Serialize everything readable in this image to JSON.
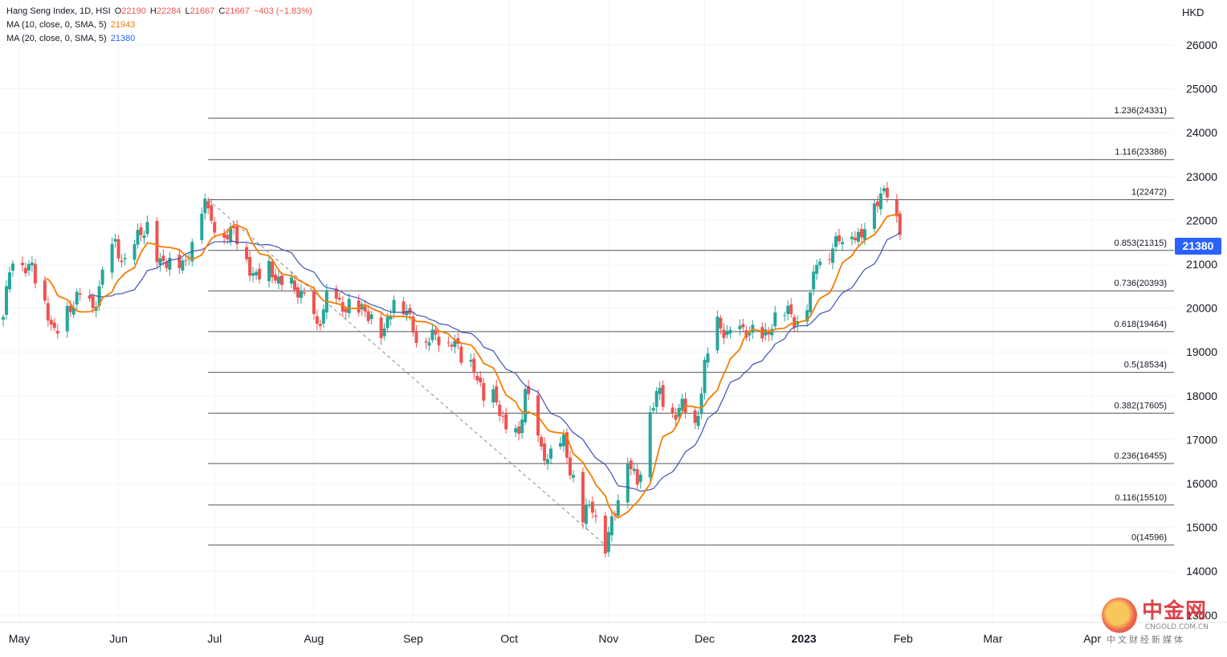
{
  "legend": {
    "symbol": "Hang Seng Index, 1D, HSI",
    "open_label": "O",
    "open": "22190",
    "high_label": "H",
    "high": "22284",
    "low_label": "L",
    "low": "21667",
    "close_label": "C",
    "close": "21667",
    "change": "−403 (−1.83%)",
    "ma10_label": "MA (10, close, 0, SMA, 5)",
    "ma10_value": "21943",
    "ma20_label": "MA (20, close, 0, SMA, 5)",
    "ma20_value": "21380"
  },
  "currency": "HKD",
  "last_price_badge": "21380",
  "watermark": {
    "title": "中金网",
    "url": "CNGOLD.COM.CN",
    "subtitle": "中文财经新媒体"
  },
  "colors": {
    "up": "#26a69a",
    "down": "#ef5350",
    "ma10": "#f57c00",
    "ma20": "#3f51b5",
    "fib_line": "#555555",
    "badge": "#2962ff",
    "legend_red": "#ef5350",
    "legend_orange": "#f57c00",
    "legend_blue": "#2962ff"
  },
  "chart_data": {
    "type": "candlestick",
    "title": "Hang Seng Index, 1D, HSI",
    "ylabel": "HKD",
    "ylim": [
      13000,
      26700
    ],
    "y_ticks": [
      26000,
      25000,
      24000,
      23000,
      22000,
      21000,
      20000,
      19000,
      18000,
      17000,
      16000,
      15000,
      14000,
      13000
    ],
    "x_ticks": [
      {
        "label": "May",
        "date": "2022-05-01"
      },
      {
        "label": "Jun",
        "date": "2022-06-01"
      },
      {
        "label": "Jul",
        "date": "2022-07-01"
      },
      {
        "label": "Aug",
        "date": "2022-08-01"
      },
      {
        "label": "Sep",
        "date": "2022-09-01"
      },
      {
        "label": "Oct",
        "date": "2022-10-01"
      },
      {
        "label": "Nov",
        "date": "2022-11-01"
      },
      {
        "label": "Dec",
        "date": "2022-12-01"
      },
      {
        "label": "2023",
        "date": "2023-01-01",
        "bold": true
      },
      {
        "label": "Feb",
        "date": "2023-02-01"
      },
      {
        "label": "Mar",
        "date": "2023-03-01"
      },
      {
        "label": "Apr",
        "date": "2023-04-01"
      }
    ],
    "x_range": [
      "2022-04-26",
      "2023-04-10"
    ],
    "fibonacci": {
      "from": {
        "date": "2022-06-29",
        "price": 22472
      },
      "to": {
        "date": "2022-10-31",
        "price": 14596
      },
      "x_start": "2022-06-29",
      "levels": [
        {
          "label": "1.236(24331)",
          "price": 24331
        },
        {
          "label": "1.116(23386)",
          "price": 23386
        },
        {
          "label": "1(22472)",
          "price": 22472
        },
        {
          "label": "0.853(21315)",
          "price": 21315
        },
        {
          "label": "0.736(20393)",
          "price": 20393
        },
        {
          "label": "0.618(19464)",
          "price": 19464
        },
        {
          "label": "0.5(18534)",
          "price": 18534
        },
        {
          "label": "0.382(17605)",
          "price": 17605
        },
        {
          "label": "0.236(16455)",
          "price": 16455
        },
        {
          "label": "0.116(15510)",
          "price": 15510
        },
        {
          "label": "0(14596)",
          "price": 14596
        }
      ]
    },
    "closes": [
      {
        "date": "2022-04-26",
        "close": 19934
      },
      {
        "date": "2022-04-29",
        "close": 21089
      },
      {
        "date": "2022-05-05",
        "close": 21000
      },
      {
        "date": "2022-05-09",
        "close": 20000
      },
      {
        "date": "2022-05-12",
        "close": 19380
      },
      {
        "date": "2022-05-16",
        "close": 19950
      },
      {
        "date": "2022-05-19",
        "close": 20120
      },
      {
        "date": "2022-05-24",
        "close": 20110
      },
      {
        "date": "2022-05-27",
        "close": 20697
      },
      {
        "date": "2022-05-31",
        "close": 21415
      },
      {
        "date": "2022-06-03",
        "close": 21082
      },
      {
        "date": "2022-06-07",
        "close": 21531
      },
      {
        "date": "2022-06-10",
        "close": 21806
      },
      {
        "date": "2022-06-14",
        "close": 21067
      },
      {
        "date": "2022-06-17",
        "close": 21075
      },
      {
        "date": "2022-06-22",
        "close": 21008
      },
      {
        "date": "2022-06-24",
        "close": 21719
      },
      {
        "date": "2022-06-28",
        "close": 22418
      },
      {
        "date": "2022-06-29",
        "close": 22000
      },
      {
        "date": "2022-07-04",
        "close": 21800
      },
      {
        "date": "2022-07-07",
        "close": 21643
      },
      {
        "date": "2022-07-11",
        "close": 21124
      },
      {
        "date": "2022-07-14",
        "close": 20751
      },
      {
        "date": "2022-07-18",
        "close": 20846
      },
      {
        "date": "2022-07-21",
        "close": 20575
      },
      {
        "date": "2022-07-25",
        "close": 20562
      },
      {
        "date": "2022-07-28",
        "close": 20200
      },
      {
        "date": "2022-08-02",
        "close": 19689
      },
      {
        "date": "2022-08-05",
        "close": 20201
      },
      {
        "date": "2022-08-09",
        "close": 20003
      },
      {
        "date": "2022-08-12",
        "close": 20175
      },
      {
        "date": "2022-08-16",
        "close": 19830
      },
      {
        "date": "2022-08-19",
        "close": 19773
      },
      {
        "date": "2022-08-23",
        "close": 19503
      },
      {
        "date": "2022-08-26",
        "close": 20170
      },
      {
        "date": "2022-08-30",
        "close": 19949
      },
      {
        "date": "2022-09-02",
        "close": 19452
      },
      {
        "date": "2022-09-06",
        "close": 19202
      },
      {
        "date": "2022-09-09",
        "close": 19362
      },
      {
        "date": "2022-09-13",
        "close": 19326
      },
      {
        "date": "2022-09-16",
        "close": 18761
      },
      {
        "date": "2022-09-20",
        "close": 18781
      },
      {
        "date": "2022-09-23",
        "close": 17933
      },
      {
        "date": "2022-09-27",
        "close": 17860
      },
      {
        "date": "2022-09-30",
        "close": 17223
      },
      {
        "date": "2022-10-04",
        "close": 17079
      },
      {
        "date": "2022-10-06",
        "close": 18013
      },
      {
        "date": "2022-10-11",
        "close": 16832
      },
      {
        "date": "2022-10-14",
        "close": 16587
      },
      {
        "date": "2022-10-18",
        "close": 16914
      },
      {
        "date": "2022-10-21",
        "close": 16211
      },
      {
        "date": "2022-10-24",
        "close": 15180
      },
      {
        "date": "2022-10-27",
        "close": 15427
      },
      {
        "date": "2022-10-31",
        "close": 14687
      },
      {
        "date": "2022-11-03",
        "close": 15339
      },
      {
        "date": "2022-11-07",
        "close": 16595
      },
      {
        "date": "2022-11-10",
        "close": 16081
      },
      {
        "date": "2022-11-14",
        "close": 17619
      },
      {
        "date": "2022-11-17",
        "close": 18045
      },
      {
        "date": "2022-11-21",
        "close": 17655
      },
      {
        "date": "2022-11-24",
        "close": 17660
      },
      {
        "date": "2022-11-28",
        "close": 17297
      },
      {
        "date": "2022-12-01",
        "close": 18736
      },
      {
        "date": "2022-12-05",
        "close": 19518
      },
      {
        "date": "2022-12-08",
        "close": 19450
      },
      {
        "date": "2022-12-12",
        "close": 19463
      },
      {
        "date": "2022-12-15",
        "close": 19368
      },
      {
        "date": "2022-12-19",
        "close": 19352
      },
      {
        "date": "2022-12-22",
        "close": 19679
      },
      {
        "date": "2022-12-28",
        "close": 19898
      },
      {
        "date": "2022-12-30",
        "close": 19781
      },
      {
        "date": "2023-01-03",
        "close": 20145
      },
      {
        "date": "2023-01-05",
        "close": 21052
      },
      {
        "date": "2023-01-09",
        "close": 21388
      },
      {
        "date": "2023-01-12",
        "close": 21514
      },
      {
        "date": "2023-01-16",
        "close": 21746
      },
      {
        "date": "2023-01-19",
        "close": 21650
      },
      {
        "date": "2023-01-20",
        "close": 22045
      },
      {
        "date": "2023-01-26",
        "close": 22566
      },
      {
        "date": "2023-01-27",
        "close": 22689
      },
      {
        "date": "2023-01-30",
        "close": 22070
      },
      {
        "date": "2023-01-31",
        "close": 21667
      }
    ],
    "series": [
      {
        "name": "MA (10, close, 0, SMA, 5)",
        "last": 21943
      },
      {
        "name": "MA (20, close, 0, SMA, 5)",
        "last": 21380
      }
    ]
  }
}
